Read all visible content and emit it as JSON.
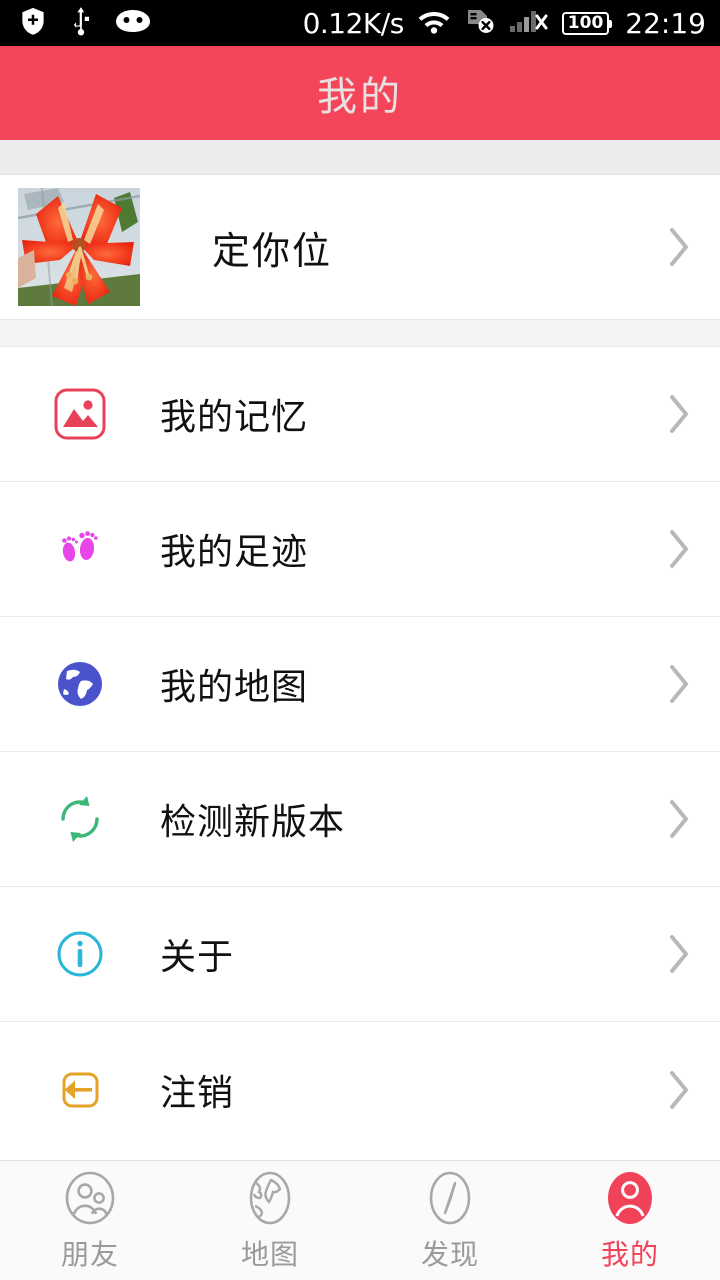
{
  "status_bar": {
    "left_icons": [
      "shield-plus-icon",
      "usb-icon",
      "android-face-icon"
    ],
    "network_speed": "0.12K/s",
    "wifi_icon": "wifi-icon",
    "sim_icon": "sim-card-disabled-icon",
    "signal_icon": "signal-no-service-icon",
    "battery_level": "100",
    "time": "22:19",
    "background": "#000000"
  },
  "header": {
    "title": "我的",
    "background": "#f4455a",
    "title_color": "#e9e1e1"
  },
  "profile": {
    "avatar_icon": "flower-photo-avatar",
    "name": "定你位",
    "chevron": "chevron-right-icon"
  },
  "menu": {
    "items": [
      {
        "label": "我的记忆",
        "icon": "photo-image-icon",
        "icon_color": "#e8415a",
        "chevron": "chevron-right-icon"
      },
      {
        "label": "我的足迹",
        "icon": "footprints-icon",
        "icon_color": "#e846e8",
        "chevron": "chevron-right-icon"
      },
      {
        "label": "我的地图",
        "icon": "globe-icon",
        "icon_color": "#4a52cc",
        "chevron": "chevron-right-icon"
      },
      {
        "label": "检测新版本",
        "icon": "refresh-sync-icon",
        "icon_color": "#3bb878",
        "chevron": "chevron-right-icon"
      },
      {
        "label": "关于",
        "icon": "info-circle-icon",
        "icon_color": "#29b6d8",
        "chevron": "chevron-right-icon"
      },
      {
        "label": "注销",
        "icon": "logout-icon",
        "icon_color": "#e5a32a",
        "chevron": "chevron-right-icon"
      }
    ]
  },
  "tabbar": {
    "active_index": 3,
    "active_color": "#f0435a",
    "inactive_color": "#9a9a9a",
    "tabs": [
      {
        "label": "朋友",
        "icon": "friends-icon"
      },
      {
        "label": "地图",
        "icon": "map-globe-icon"
      },
      {
        "label": "发现",
        "icon": "compass-icon"
      },
      {
        "label": "我的",
        "icon": "user-profile-icon"
      }
    ]
  }
}
